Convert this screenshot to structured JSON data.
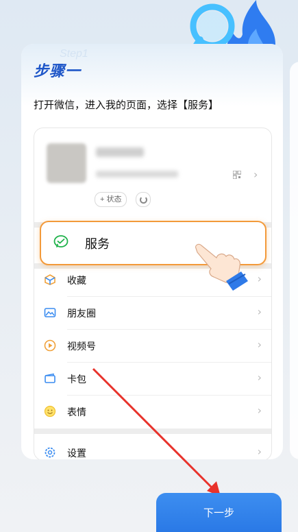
{
  "step": {
    "title": "步骤一",
    "watermark": "Step1",
    "instruction": "打开微信，进入我的页面，选择【服务】"
  },
  "profile": {
    "status_label": "+ 状态"
  },
  "highlight": {
    "label": "服务",
    "icon": "wechat-pay-icon"
  },
  "menu": {
    "items": [
      {
        "label": "收藏",
        "icon": "favorites-cube-icon"
      },
      {
        "label": "朋友圈",
        "icon": "moments-image-icon"
      },
      {
        "label": "视频号",
        "icon": "channels-play-icon"
      },
      {
        "label": "卡包",
        "icon": "card-wallet-icon"
      },
      {
        "label": "表情",
        "icon": "smile-emoji-icon"
      },
      {
        "label": "设置",
        "icon": "settings-gear-icon"
      }
    ]
  },
  "next_button": {
    "label": "下一步"
  },
  "colors": {
    "accent_blue": "#2a79e6",
    "title_blue": "#1e56c8",
    "highlight_orange": "#f39a3a",
    "arrow_red": "#e8322b"
  }
}
